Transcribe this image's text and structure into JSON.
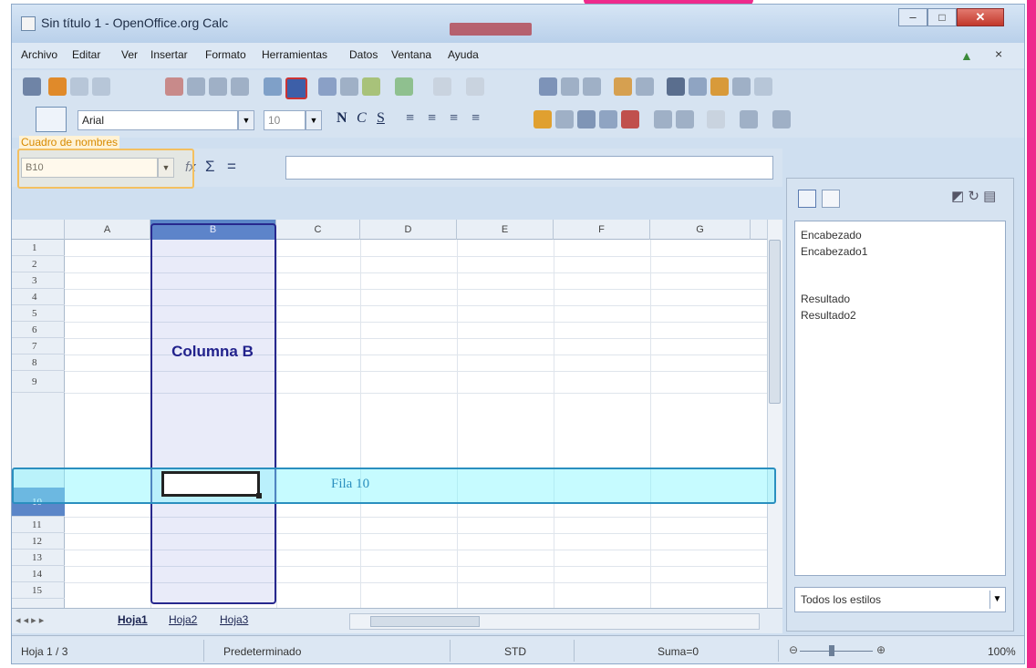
{
  "window": {
    "title": "Sin título 1 - OpenOffice.org Calc"
  },
  "titlebar": {
    "minimize_icon": "minimize-icon",
    "maximize_icon": "maximize-icon",
    "close_icon": "close-icon",
    "min_glyph": "–",
    "max_glyph": "□",
    "close_glyph": "✕"
  },
  "menu": {
    "items": [
      "Archivo",
      "Editar",
      "Ver",
      "Insertar",
      "Formato",
      "Herramientas",
      "Datos",
      "Ventana",
      "Ayuda"
    ],
    "close_glyph": "×"
  },
  "format_toolbar": {
    "font_name": "Arial",
    "font_size": "10",
    "bold": "N",
    "italic": "C",
    "underline": "S"
  },
  "formula_bar": {
    "name_box_label": "Cuadro de nombres",
    "name_box_value": "B10",
    "function_wizard": "fx",
    "sum_glyph": "Σ",
    "equals_glyph": "="
  },
  "grid": {
    "columns": [
      "A",
      "B",
      "C",
      "D",
      "E",
      "F",
      "G"
    ],
    "rows": [
      "1",
      "2",
      "3",
      "4",
      "5",
      "6",
      "7",
      "8",
      "9",
      "10",
      "11",
      "12",
      "13",
      "14",
      "15"
    ],
    "active_cell": "B10",
    "column_highlight_label": "Columna B",
    "row_highlight_label": "Fila 10"
  },
  "sheets": {
    "tabs": [
      "Hoja1",
      "Hoja2",
      "Hoja3"
    ],
    "nav": "◂ ◂ ▸ ▸"
  },
  "sidebar": {
    "styles": [
      "Encabezado",
      "Encabezado1",
      "Resultado",
      "Resultado2"
    ],
    "filter": "Todos los estilos",
    "right_icons": "◩ ↻ ▤"
  },
  "status_bar": {
    "sheet": "Hoja 1 / 3",
    "page_style": "Predeterminado",
    "mode": "STD",
    "sum": "Suma=0",
    "zoom": "100%",
    "zoom_minus": "⊖",
    "zoom_plus": "⊕"
  },
  "colors": {
    "row_highlight_border": "#2a8fbf",
    "column_highlight_border": "#27288e",
    "name_box_highlight": "#f4c060",
    "frame_accent": "#ee2a8c"
  }
}
